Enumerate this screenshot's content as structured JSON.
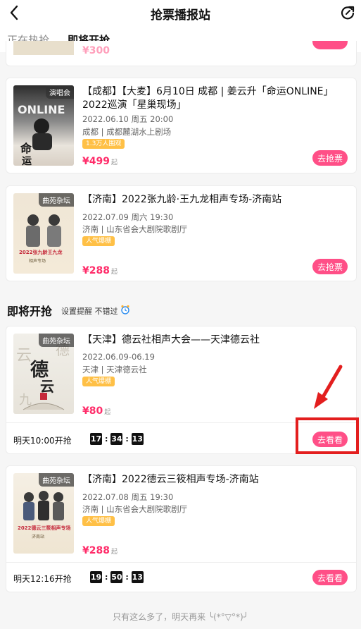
{
  "header": {
    "title": "抢票播报站"
  },
  "tabs": [
    {
      "label": "正在热抢"
    },
    {
      "label": "即将开抢"
    }
  ],
  "prev_price": "¥300",
  "hot": [
    {
      "poster_tag": "演唱会",
      "title": "【成都】【大麦】6月10日 成都 | 姜云升「命运ONLINE」2022巡演「星巢现场」",
      "date": "2022.06.10 周五 20:00",
      "venue": "成都 | 成都麓湖水上剧场",
      "badge": "1.3万人围观",
      "price": "¥499",
      "price_unit": "起",
      "button": "去抢票"
    },
    {
      "poster_tag": "曲苑杂坛",
      "title": "【济南】2022张九龄·王九龙相声专场-济南站",
      "date": "2022.07.09 周六 19:30",
      "venue": "济南 | 山东省会大剧院歌剧厅",
      "badge": "人气爆棚",
      "price": "¥288",
      "price_unit": "起",
      "button": "去抢票"
    }
  ],
  "upcoming_section": {
    "title": "即将开抢",
    "subtitle": "设置提醒 不错过"
  },
  "upcoming": [
    {
      "poster_tag": "曲苑杂坛",
      "title": "【天津】德云社相声大会——天津德云社",
      "date": "2022.06.09-06.19",
      "venue": "天津 | 天津德云社",
      "badge": "人气爆棚",
      "price": "¥80",
      "price_unit": "起",
      "start_label": "明天10:00开抢",
      "countdown": [
        "17",
        "34",
        "13"
      ],
      "button": "去看看"
    },
    {
      "poster_tag": "曲苑杂坛",
      "title": "【济南】2022德云三筱相声专场-济南站",
      "date": "2022.07.08 周五 19:30",
      "venue": "济南 | 山东省会大剧院歌剧厅",
      "badge": "人气爆棚",
      "price": "¥288",
      "price_unit": "起",
      "start_label": "明天12:16开抢",
      "countdown": [
        "19",
        "50",
        "13"
      ],
      "button": "去看看"
    }
  ],
  "footer": "只有这么多了，明天再来 ╰(*°▽°*)╯",
  "colors": {
    "accent": "#ff4f87",
    "price": "#ff2d6a",
    "badge": "#ffc046",
    "highlight": "#e31e1e"
  }
}
